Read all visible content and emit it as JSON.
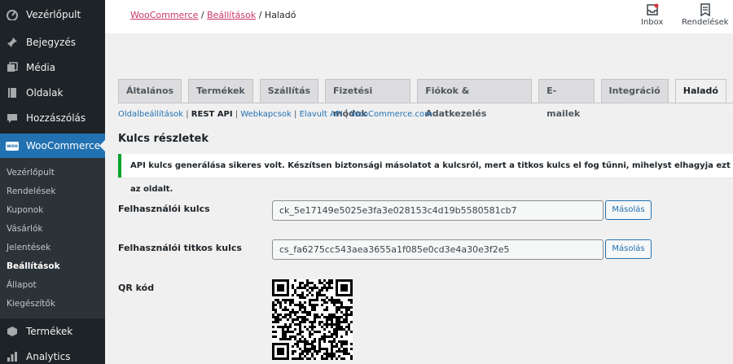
{
  "sidebar": {
    "top_items": [
      {
        "label": "Vezérlőpult",
        "icon": "dashboard-icon"
      },
      {
        "label": "Bejegyzés",
        "icon": "pin-icon"
      },
      {
        "label": "Média",
        "icon": "media-icon"
      },
      {
        "label": "Oldalak",
        "icon": "pages-icon"
      },
      {
        "label": "Hozzászólás",
        "icon": "comments-icon"
      }
    ],
    "active": {
      "label": "WooCommerce",
      "icon": "woocommerce-icon",
      "badge": "woo"
    },
    "submenu": [
      "Vezérlőpult",
      "Rendelések",
      "Kuponok",
      "Vásárlók",
      "Jelentések",
      "Beállítások",
      "Állapot",
      "Kiegészítők"
    ],
    "current_sub": "Beállítások",
    "bottom_items": [
      {
        "label": "Termékek",
        "icon": "products-icon"
      },
      {
        "label": "Analytics",
        "icon": "analytics-icon"
      }
    ]
  },
  "header": {
    "breadcrumb": {
      "link1": "WooCommerce",
      "sep1": " / ",
      "link2": "Beállítások",
      "sep2": " / ",
      "current": "Haladó"
    },
    "inbox_label": "Inbox",
    "orders_label": "Rendelések"
  },
  "tabs": [
    "Általános",
    "Termékek",
    "Szállítás",
    "Fizetési módok",
    "Fiókok & Adatkezelés",
    "E-mailek",
    "Integráció",
    "Haladó"
  ],
  "active_tab": "Haladó",
  "sublinks": {
    "page_settings": "Oldalbeállítások",
    "rest_api": "REST API",
    "webhooks": "Webkapcsok",
    "legacy_api": "Elavult API",
    "wc_com": "WooCommerce.com",
    "separator": " | "
  },
  "section_title": "Kulcs részletek",
  "notice": "API kulcs generálása sikeres volt. Készítsen biztonsági másolatot a kulcsról, mert a titkos kulcs el fog tűnni, mihelyst elhagyja ezt az oldalt.",
  "consumer_key": {
    "label": "Felhasználói kulcs",
    "value": "ck_5e17149e5025e3fa3e028153c4d19b5580581cb7",
    "button": "Másolás"
  },
  "consumer_secret": {
    "label": "Felhasználói titkos kulcs",
    "value": "cs_fa6275cc543aea3655a1f085e0cd3e4a30e3f2e5",
    "button": "Másolás"
  },
  "qr_label": "QR kód",
  "colors": {
    "accent": "#2271b1",
    "woo": "#c9356e",
    "success": "#00a32a",
    "sidebar": "#1d2327"
  }
}
